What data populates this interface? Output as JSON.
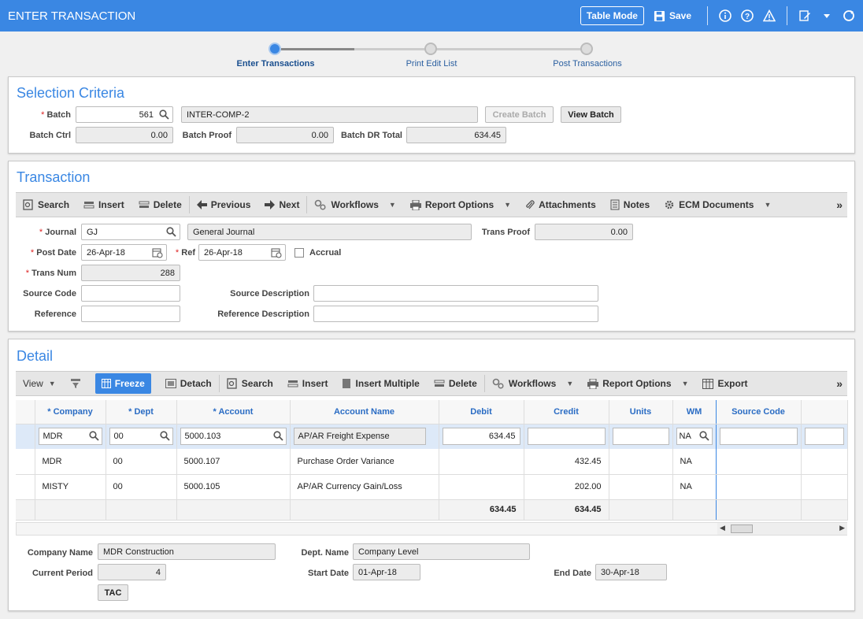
{
  "header": {
    "title": "ENTER TRANSACTION",
    "table_mode": "Table Mode",
    "save": "Save"
  },
  "steps": [
    {
      "label": "Enter Transactions"
    },
    {
      "label": "Print Edit List"
    },
    {
      "label": "Post Transactions"
    }
  ],
  "selection": {
    "title": "Selection Criteria",
    "batch_label": "Batch",
    "batch_value": "561",
    "batch_name": "INTER-COMP-2",
    "create_batch": "Create Batch",
    "view_batch": "View Batch",
    "batch_ctrl_label": "Batch Ctrl",
    "batch_ctrl": "0.00",
    "batch_proof_label": "Batch Proof",
    "batch_proof": "0.00",
    "batch_dr_label": "Batch DR Total",
    "batch_dr": "634.45"
  },
  "transaction": {
    "title": "Transaction",
    "toolbar": {
      "search": "Search",
      "insert": "Insert",
      "delete": "Delete",
      "previous": "Previous",
      "next": "Next",
      "workflows": "Workflows",
      "report_options": "Report Options",
      "attachments": "Attachments",
      "notes": "Notes",
      "ecm": "ECM Documents",
      "more": "»"
    },
    "journal_label": "Journal",
    "journal": "GJ",
    "journal_name": "General Journal",
    "trans_proof_label": "Trans Proof",
    "trans_proof": "0.00",
    "post_date_label": "Post Date",
    "post_date": "26-Apr-18",
    "ref_label": "Ref",
    "ref": "26-Apr-18",
    "accrual_label": "Accrual",
    "trans_num_label": "Trans Num",
    "trans_num": "288",
    "source_code_label": "Source Code",
    "source_desc_label": "Source Description",
    "reference_label": "Reference",
    "reference_desc_label": "Reference Description"
  },
  "detail": {
    "title": "Detail",
    "toolbar": {
      "view": "View",
      "freeze": "Freeze",
      "detach": "Detach",
      "search": "Search",
      "insert": "Insert",
      "insert_multiple": "Insert Multiple",
      "delete": "Delete",
      "workflows": "Workflows",
      "report_options": "Report Options",
      "export": "Export",
      "more": "»"
    },
    "columns": {
      "company": "Company",
      "dept": "Dept",
      "account": "Account",
      "account_name": "Account Name",
      "debit": "Debit",
      "credit": "Credit",
      "units": "Units",
      "wm": "WM",
      "source_code": "Source Code"
    },
    "edit_row": {
      "company": "MDR",
      "dept": "00",
      "account": "5000.103",
      "account_name": "AP/AR Freight Expense",
      "debit": "634.45",
      "credit": "",
      "units": "",
      "wm": "NA",
      "source_code": ""
    },
    "rows": [
      {
        "company": "MDR",
        "dept": "00",
        "account": "5000.107",
        "account_name": "Purchase Order Variance",
        "debit": "",
        "credit": "432.45",
        "units": "",
        "wm": "NA"
      },
      {
        "company": "MISTY",
        "dept": "00",
        "account": "5000.105",
        "account_name": "AP/AR Currency Gain/Loss",
        "debit": "",
        "credit": "202.00",
        "units": "",
        "wm": "NA"
      }
    ],
    "totals": {
      "debit": "634.45",
      "credit": "634.45"
    },
    "company_name_label": "Company Name",
    "company_name": "MDR Construction",
    "dept_name_label": "Dept. Name",
    "dept_name": "Company Level",
    "current_period_label": "Current Period",
    "current_period": "4",
    "start_date_label": "Start Date",
    "start_date": "01-Apr-18",
    "end_date_label": "End Date",
    "end_date": "30-Apr-18",
    "tac": "TAC"
  }
}
